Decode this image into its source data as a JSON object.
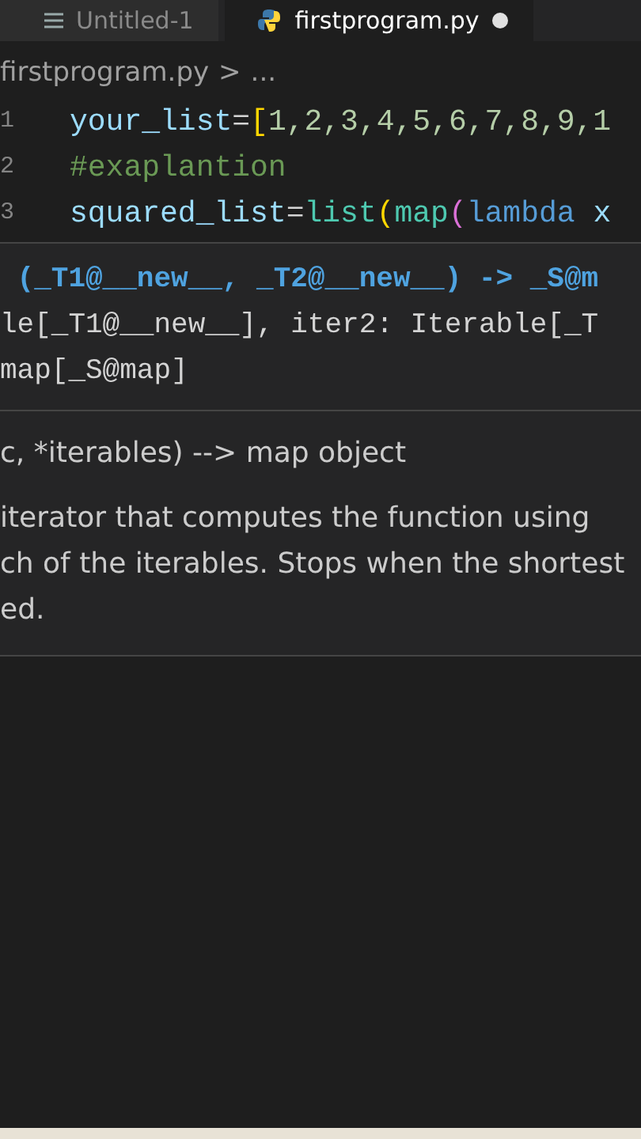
{
  "tabs": [
    {
      "label": "Untitled-1",
      "kind": "plain",
      "selected": false,
      "modified": false
    },
    {
      "label": "firstprogram.py",
      "kind": "python",
      "selected": true,
      "modified": true
    }
  ],
  "breadcrumb": {
    "file": "firstprogram.py",
    "separator": ">",
    "trail": "..."
  },
  "code_lines": [
    {
      "number": "1",
      "tokens": [
        {
          "text": "your_list",
          "kind": "var"
        },
        {
          "text": "=",
          "kind": "op"
        },
        {
          "text": "[",
          "kind": "bracket"
        },
        {
          "text": "1,2,3,4,5,6,7,8,9,1",
          "kind": "num"
        }
      ]
    },
    {
      "number": "2",
      "tokens": [
        {
          "text": "#exaplantion",
          "kind": "comment"
        }
      ]
    },
    {
      "number": "3",
      "tokens": [
        {
          "text": "squared_list",
          "kind": "var"
        },
        {
          "text": "=",
          "kind": "op"
        },
        {
          "text": "list",
          "kind": "type"
        },
        {
          "text": "(",
          "kind": "bracket"
        },
        {
          "text": "map",
          "kind": "type"
        },
        {
          "text": "(",
          "kind": "bracket2"
        },
        {
          "text": "lambda",
          "kind": "keyword"
        },
        {
          "text": " x",
          "kind": "var"
        }
      ]
    }
  ],
  "hover": {
    "signature": [
      {
        "text": " (_T1@__new__, _T2@__new__) -> _S@m",
        "active": true
      },
      {
        "text": "le[_T1@__new__], iter2: Iterable[_T",
        "active": false
      },
      {
        "text": "map[_S@map]",
        "active": false
      }
    ],
    "doc": [
      "c, *iterables) --> map object",
      "iterator that computes the function using",
      "ch of the iterables. Stops when the shortest",
      "ed."
    ]
  }
}
